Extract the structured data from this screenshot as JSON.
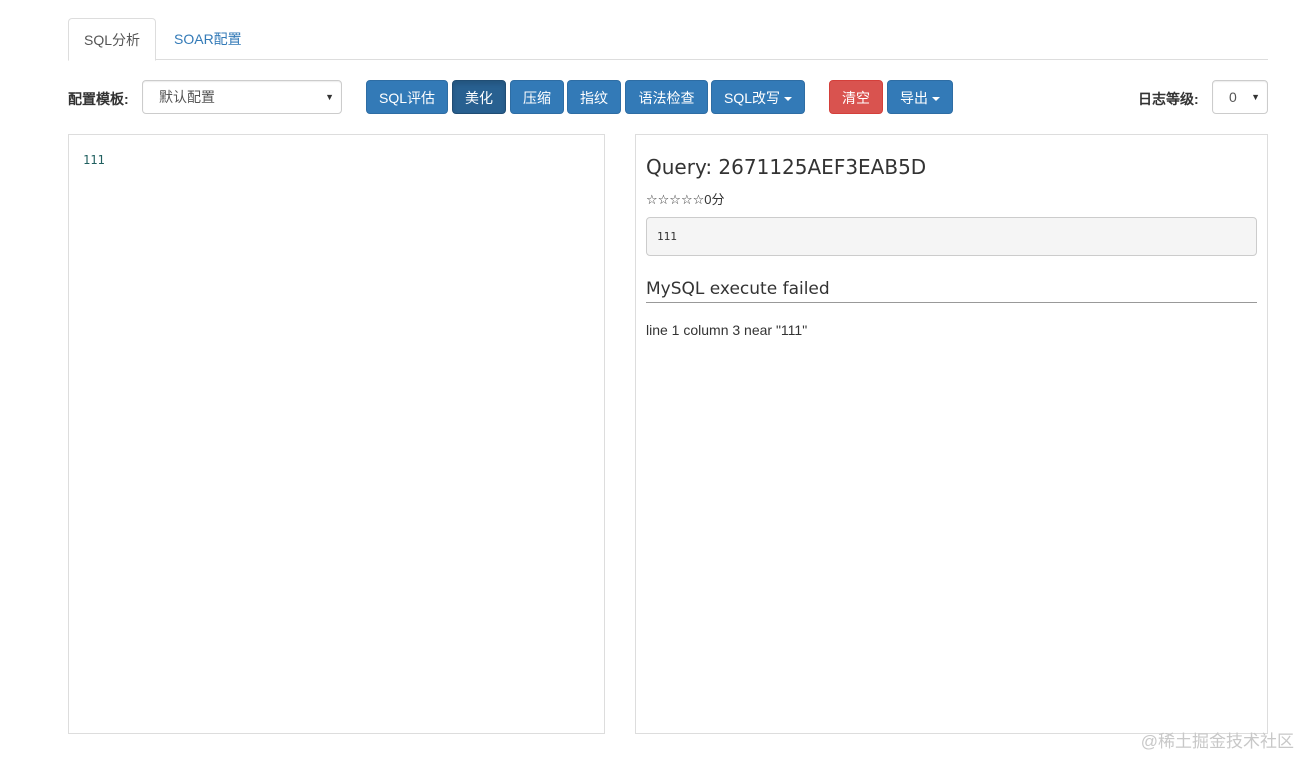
{
  "tabs": [
    {
      "label": "SQL分析",
      "active": true
    },
    {
      "label": "SOAR配置",
      "active": false
    }
  ],
  "toolbar": {
    "template_label": "配置模板:",
    "template_value": "默认配置",
    "buttons": {
      "evaluate": "SQL评估",
      "beautify": "美化",
      "compress": "压缩",
      "fingerprint": "指纹",
      "syntax_check": "语法检查",
      "rewrite": "SQL改写",
      "clear": "清空",
      "export": "导出"
    },
    "log_level_label": "日志等级:",
    "log_level_value": "0"
  },
  "editor": {
    "content": "111"
  },
  "result": {
    "query_title": "Query: 2671125AEF3EAB5D",
    "score": "☆☆☆☆☆0分",
    "sql": "111",
    "error_title": "MySQL execute failed",
    "error_message": "line 1 column 3 near \"111\""
  },
  "watermark": "@稀土掘金技术社区",
  "colors": {
    "primary": "#337ab7",
    "primary_active": "#286090",
    "danger": "#d9534f"
  }
}
